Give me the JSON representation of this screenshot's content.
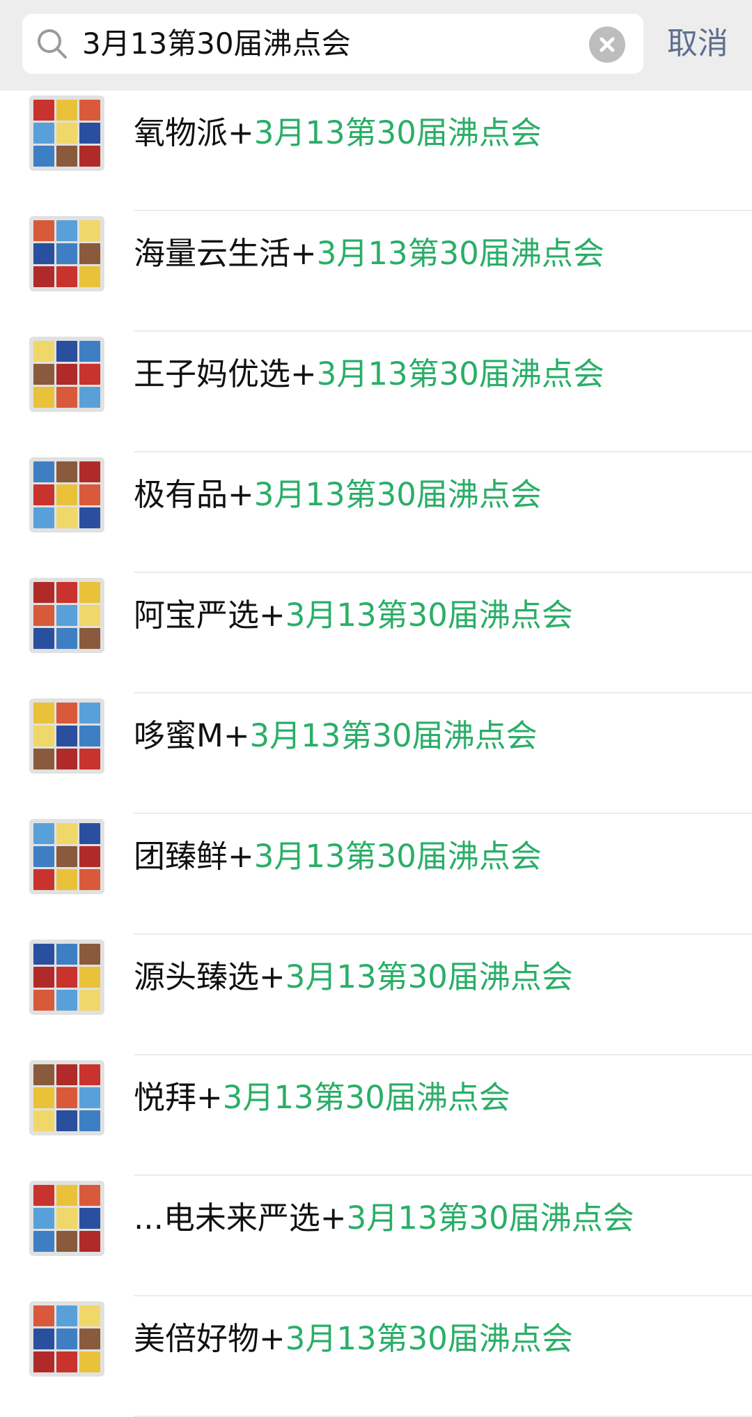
{
  "search": {
    "query": "3月13第30届沸点会",
    "cancel_label": "取消"
  },
  "colors": {
    "highlight": "#2aae67",
    "text": "#111111",
    "cancel": "#5f6f8e"
  },
  "results": [
    {
      "name": "氧物派+",
      "match": "3月13第30届沸点会"
    },
    {
      "name": "海量云生活+",
      "match": "3月13第30届沸点会"
    },
    {
      "name": "王子妈优选+",
      "match": "3月13第30届沸点会"
    },
    {
      "name": "极有品+",
      "match": "3月13第30届沸点会"
    },
    {
      "name": "阿宝严选+",
      "match": "3月13第30届沸点会"
    },
    {
      "name": "哆蜜M+",
      "match": "3月13第30届沸点会"
    },
    {
      "name": "团臻鲜+",
      "match": "3月13第30届沸点会"
    },
    {
      "name": "源头臻选+",
      "match": "3月13第30届沸点会"
    },
    {
      "name": "悦拜+",
      "match": "3月13第30届沸点会"
    },
    {
      "name": "...电未来严选+",
      "match": "3月13第30届沸点会"
    },
    {
      "name": "美倍好物+",
      "match": "3月13第30届沸点会"
    }
  ]
}
